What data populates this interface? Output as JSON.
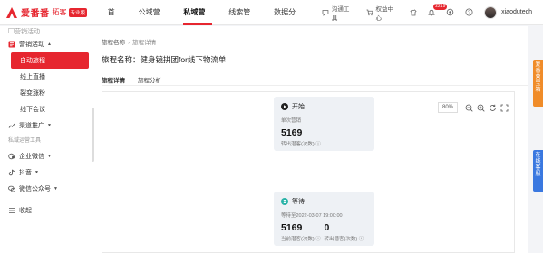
{
  "brand": {
    "name": "爱番番",
    "sub": "拓客",
    "edition": "专业版",
    "color": "#e6262f"
  },
  "nav": [
    {
      "label": "首页",
      "active": false
    },
    {
      "label": "公域营销",
      "active": false
    },
    {
      "label": "私域营销",
      "active": true
    },
    {
      "label": "线索管家",
      "active": false
    },
    {
      "label": "数据分析",
      "active": false
    }
  ],
  "tools": {
    "chat": "沟通工具",
    "rights": "权益中心"
  },
  "notification_count": "2219",
  "user": {
    "name": "xiaodutech"
  },
  "sidebar": {
    "cut_item": "营销活动",
    "group1": {
      "label": "营销活动"
    },
    "subitems": [
      "自动旅程",
      "线上直播",
      "裂变涨粉",
      "线下会议"
    ],
    "active_sub": "自动旅程",
    "group2": {
      "label": "渠道推广"
    },
    "section_label": "私域运营工具",
    "group3": {
      "label": "企业微信"
    },
    "group4": {
      "label": "抖音"
    },
    "group5": {
      "label": "微信公众号"
    },
    "collapse": "收起"
  },
  "breadcrumb": {
    "parent": "旅程名称",
    "current": "旅程详情"
  },
  "page_title": "旅程名称：健身镜拼团for线下物流单",
  "tabs": [
    {
      "label": "旅程详情",
      "active": true
    },
    {
      "label": "旅程分析",
      "active": false
    }
  ],
  "zoom": "80%",
  "nodes": {
    "start": {
      "title": "开始",
      "sub": "单次营销",
      "count": "5169",
      "count_label": "转出潜客(次数)"
    },
    "wait": {
      "title": "等待",
      "sub": "等待至2022-03-07 19:00:00",
      "left_count": "5169",
      "left_label": "当前潜客(次数)",
      "right_count": "0",
      "right_label": "转出潜客(次数)"
    }
  },
  "floats": {
    "orange": "复番营宝箱",
    "blue": "在线客服"
  }
}
